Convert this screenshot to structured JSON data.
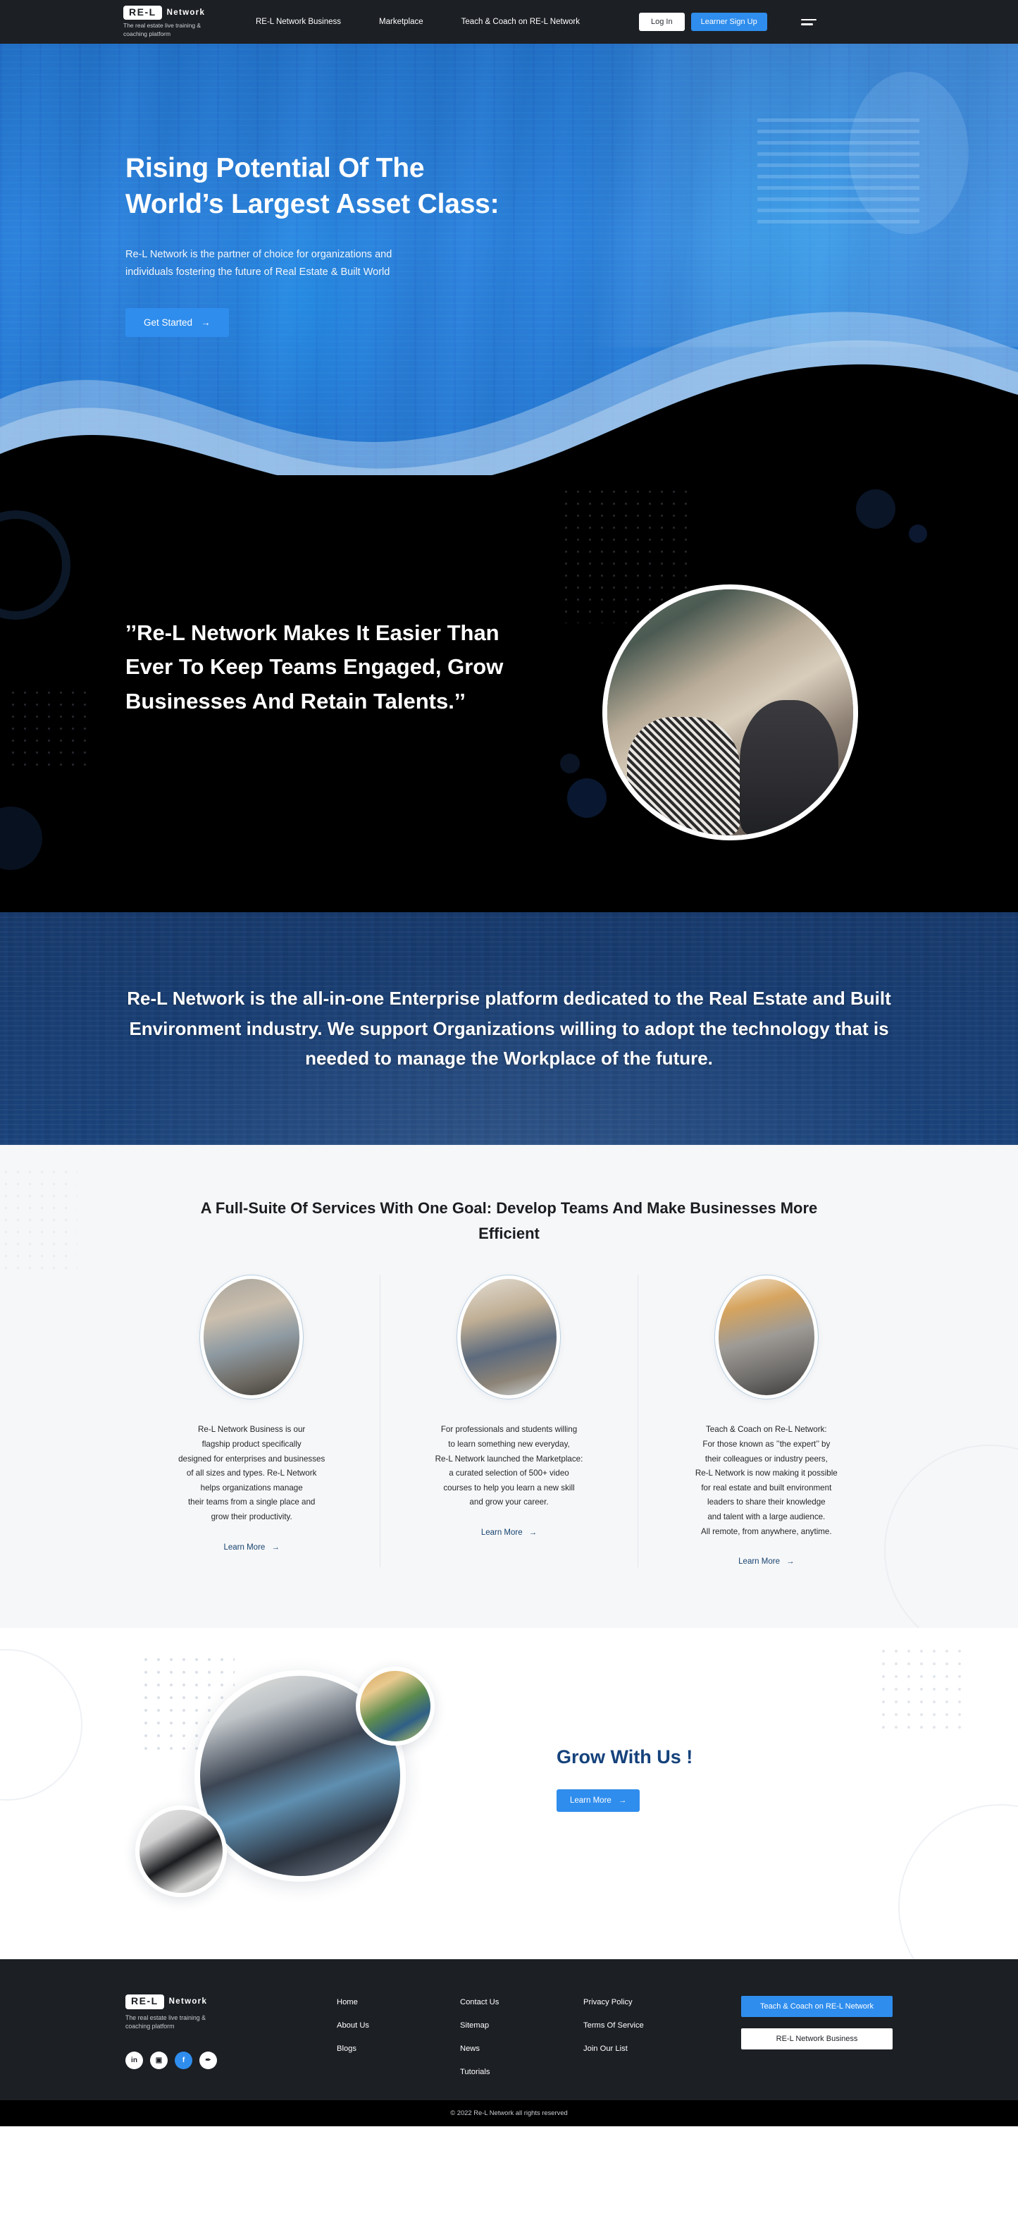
{
  "header": {
    "logo_badge": "RE-L",
    "logo_word": "Network",
    "logo_tagline": "The real estate live training & coaching platform",
    "nav": [
      {
        "label": "RE-L Network Business"
      },
      {
        "label": "Marketplace"
      },
      {
        "label": "Teach & Coach on RE-L Network"
      }
    ],
    "login_label": "Log In",
    "signup_label": "Learner Sign Up",
    "menu_icon": "hamburger-menu-icon"
  },
  "hero": {
    "title_line1": "Rising Potential Of The",
    "title_line2": "World’s Largest Asset Class:",
    "subtitle_line1": "Re-L Network is the partner of choice for organizations and",
    "subtitle_line2": "individuals fostering the future of Real Estate & Built World",
    "cta_label": "Get Started",
    "cta_arrow": "→"
  },
  "quote": {
    "text": "’’Re-L Network Makes It Easier Than Ever To Keep Teams Engaged, Grow Businesses And Retain Talents.’’",
    "image_alt": "two-people-laughing-with-laptop-in-cafe"
  },
  "statement": {
    "text": "Re-L Network is the all-in-one Enterprise platform dedicated to the Real Estate and Built Environment industry. We support Organizations willing to adopt the technology that is needed to manage the Workplace of the future."
  },
  "services": {
    "title": "A Full-Suite Of Services With One Goal: Develop Teams And Make Businesses More Efficient",
    "learn_more_label": "Learn More",
    "arrow": "→",
    "cards": [
      {
        "image_alt": "colleagues-walking-in-office-corridor",
        "text": "Re-L Network Business is our\nflagship product specifically\ndesigned for enterprises and businesses\nof all sizes and types. Re-L Network\nhelps organizations manage\ntheir teams from a single place and\ngrow their productivity."
      },
      {
        "image_alt": "student-typing-on-laptop-at-shared-table",
        "text": "For professionals and students willing\nto learn something new everyday,\nRe-L Network launched the Marketplace:\na curated selection of 500+ video\ncourses to help you learn a new skill\nand grow your career."
      },
      {
        "image_alt": "team-meeting-around-table-with-laptops",
        "text": "Teach & Coach on Re-L Network:\nFor those known as ’’the expert’’ by\ntheir colleagues or industry peers,\nRe-L Network is now making it possible\nfor real estate and built environment\nleaders to share their knowledge\nand talent with a large audience.\nAll remote, from anywhere, anytime."
      }
    ]
  },
  "grow": {
    "title": "Grow With Us !",
    "cta_label": "Learn More",
    "cta_arrow": "→",
    "image_main_alt": "agent-and-client-reviewing-documents",
    "image_top_alt": "construction-workers-on-site",
    "image_bottom_alt": "hand-drawing-architectural-blueprint"
  },
  "footer": {
    "logo_badge": "RE-L",
    "logo_word": "Network",
    "logo_tagline": "The real estate live training & coaching platform",
    "socials": [
      {
        "name": "linkedin-icon",
        "glyph": "in"
      },
      {
        "name": "instagram-icon",
        "glyph": "▣"
      },
      {
        "name": "facebook-icon",
        "glyph": "f"
      },
      {
        "name": "twitter-icon",
        "glyph": "✒"
      }
    ],
    "col1": [
      {
        "label": "Home"
      },
      {
        "label": "About Us"
      },
      {
        "label": "Blogs"
      }
    ],
    "col2": [
      {
        "label": "Contact Us"
      },
      {
        "label": "Sitemap"
      },
      {
        "label": "News"
      },
      {
        "label": "Tutorials"
      }
    ],
    "col3": [
      {
        "label": "Privacy Policy"
      },
      {
        "label": "Terms Of Service"
      },
      {
        "label": "Join Our List"
      }
    ],
    "cta_teach": "Teach & Coach on RE-L Network",
    "cta_business": "RE-L Network Business",
    "copyright": "© 2022 Re-L Network all rights reserved"
  },
  "colors": {
    "accent_blue": "#2f8ded",
    "dark": "#1c1f24",
    "deep_blue": "#15427b",
    "link_blue": "#16436f"
  }
}
